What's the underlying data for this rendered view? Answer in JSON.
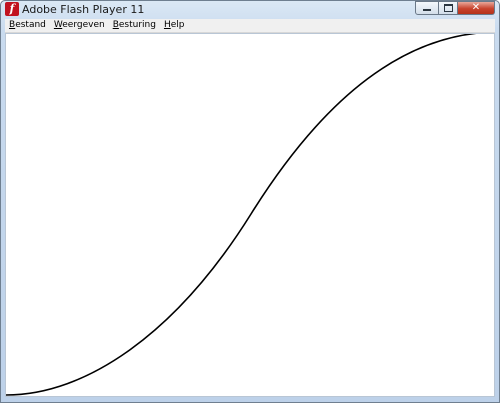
{
  "window": {
    "title": "Adobe Flash Player 11",
    "app_icon": "flash-player-icon",
    "app_icon_glyph": "f",
    "controls": {
      "minimize_icon": "minimize-icon",
      "maximize_icon": "maximize-icon",
      "close_icon": "close-icon",
      "close_glyph": "✕"
    }
  },
  "menubar": {
    "items": [
      {
        "label": "Bestand",
        "accelerator": "B",
        "rest": "estand"
      },
      {
        "label": "Weergeven",
        "accelerator": "W",
        "rest": "eergeven"
      },
      {
        "label": "Besturing",
        "accelerator": "B",
        "rest": "esturing"
      },
      {
        "label": "Help",
        "accelerator": "H",
        "rest": "elp"
      }
    ]
  },
  "stage": {
    "background": "#ffffff",
    "curve": {
      "shape": "s-curve",
      "color": "#000000"
    }
  }
}
